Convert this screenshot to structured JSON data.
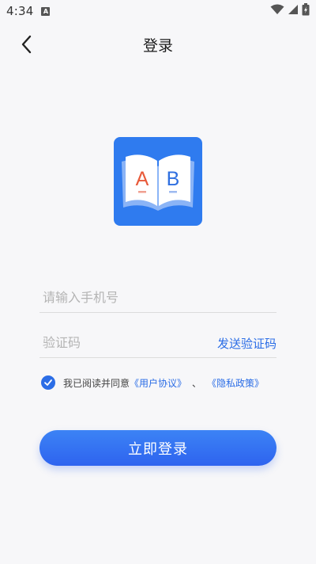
{
  "status_bar": {
    "time": "4:34",
    "notification_badge": "A"
  },
  "header": {
    "title": "登录"
  },
  "logo": {
    "letter_left": "A",
    "letter_right": "B",
    "background": "#2f7bef"
  },
  "phone_field": {
    "placeholder": "请输入手机号",
    "value": ""
  },
  "code_field": {
    "placeholder": "验证码",
    "value": ""
  },
  "send_code_label": "发送验证码",
  "agreement": {
    "checked": true,
    "prefix": "我已阅读并同意",
    "user_agreement": "《用户协议》",
    "separator": "、",
    "privacy_policy": "《隐私政策》"
  },
  "login_button_label": "立即登录",
  "colors": {
    "accent": "#2b6de6",
    "background": "#f7f7f9"
  }
}
